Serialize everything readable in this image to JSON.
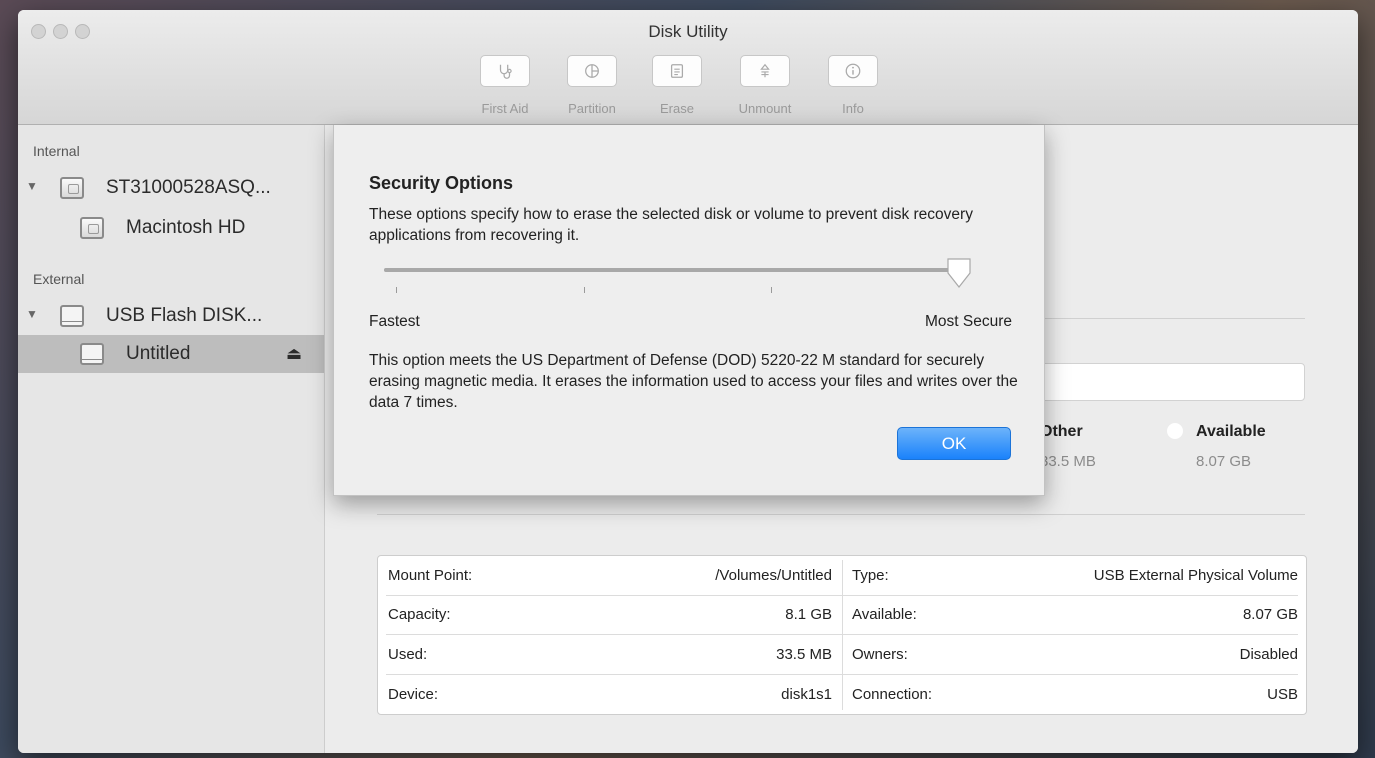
{
  "window": {
    "title": "Disk Utility"
  },
  "toolbar": {
    "buttons": [
      {
        "label": "First Aid",
        "icon": "stethoscope-icon"
      },
      {
        "label": "Partition",
        "icon": "partition-pie-icon"
      },
      {
        "label": "Erase",
        "icon": "erase-icon"
      },
      {
        "label": "Unmount",
        "icon": "unmount-icon"
      },
      {
        "label": "Info",
        "icon": "info-icon"
      }
    ]
  },
  "sidebar": {
    "internal_header": "Internal",
    "external_header": "External",
    "items": [
      {
        "label": "ST31000528ASQ...",
        "icon": "internal-disk-icon",
        "expanded": true
      },
      {
        "label": "Macintosh HD",
        "icon": "volume-icon"
      },
      {
        "label": "USB Flash DISK...",
        "icon": "usb-disk-icon",
        "expanded": true
      },
      {
        "label": "Untitled",
        "icon": "usb-volume-icon",
        "selected": true,
        "eject": "⏏"
      }
    ]
  },
  "main": {
    "legend": [
      {
        "title": "Other",
        "value": "33.5 MB"
      },
      {
        "title": "Available",
        "value": "8.07 GB"
      }
    ],
    "info_table": {
      "rows": [
        {
          "label_left": "Mount Point:",
          "value_left": "/Volumes/Untitled",
          "label_right": "Type:",
          "value_right": "USB External Physical Volume"
        },
        {
          "label_left": "Capacity:",
          "value_left": "8.1 GB",
          "label_right": "Available:",
          "value_right": "8.07 GB"
        },
        {
          "label_left": "Used:",
          "value_left": "33.5 MB",
          "label_right": "Owners:",
          "value_right": "Disabled"
        },
        {
          "label_left": "Device:",
          "value_left": "disk1s1",
          "label_right": "Connection:",
          "value_right": "USB"
        }
      ]
    }
  },
  "dialog": {
    "title": "Security Options",
    "description": "These options specify how to erase the selected disk or volume to prevent disk recovery applications from recovering it.",
    "slider": {
      "min_label": "Fastest",
      "max_label": "Most Secure",
      "positions": 4,
      "selected_index": 3
    },
    "detail": "This option meets the US Department of Defense (DOD) 5220-22 M standard for securely erasing magnetic media. It erases the information used to access your files and writes over the data 7 times.",
    "ok_label": "OK"
  },
  "colors": {
    "accent_blue": "#1a82fb",
    "selection_gray": "#bdbdbd",
    "window_bg": "#ececec"
  }
}
